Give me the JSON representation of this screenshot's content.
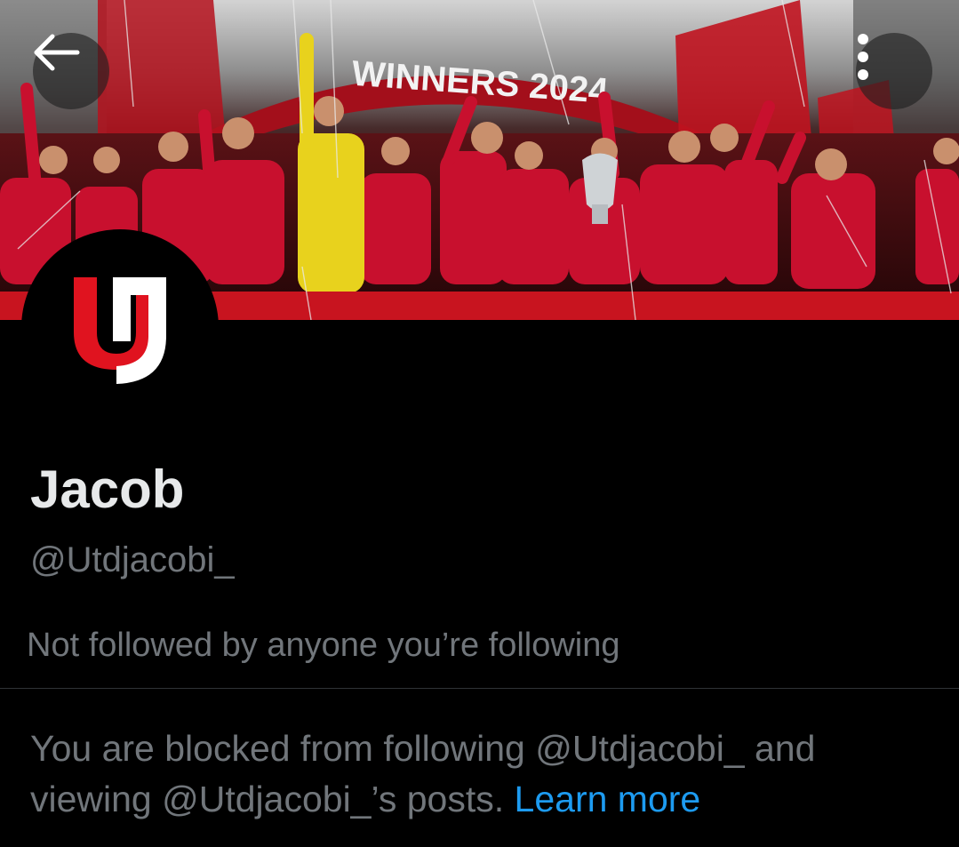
{
  "header": {
    "back_icon": "arrow-left-icon",
    "more_icon": "more-vertical-icon",
    "banner_text": "WINNERS 2024",
    "banner_colors": {
      "kit_red": "#c8102e",
      "goalkeeper_yellow": "#e8d21d",
      "board_red": "#a30f1b"
    }
  },
  "profile": {
    "avatar_logo": "red-and-white-u-logo",
    "name": "Jacob",
    "handle": "@Utdjacobi_",
    "followers_you_know": "Not followed by anyone you’re following"
  },
  "blocked": {
    "line1": "You are blocked from following @Utdjacobi_ and viewing @Utdjacobi_’s posts.",
    "learn_more": "Learn more"
  },
  "colors": {
    "background": "#000000",
    "primary_text": "#e7e9ea",
    "secondary_text": "#71767b",
    "link": "#1d9bf0",
    "divider": "#2f3336"
  }
}
